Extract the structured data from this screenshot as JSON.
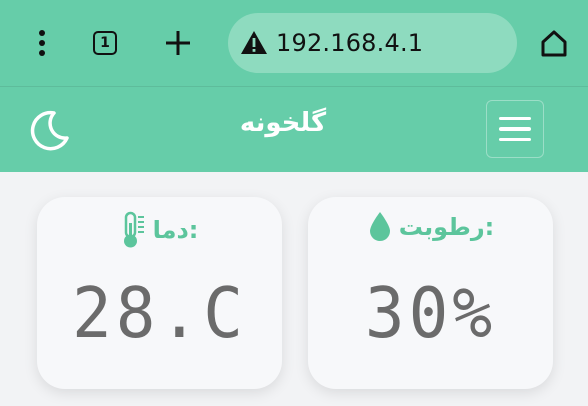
{
  "browser": {
    "tab_count": "1",
    "new_tab_label": "+",
    "url": "192.168.4.1"
  },
  "app": {
    "title": "گلخونه"
  },
  "cards": {
    "temperature": {
      "label": "دما:",
      "icon": "thermometer-icon",
      "value": "28.C"
    },
    "humidity": {
      "label": "رطوبت:",
      "icon": "water-drop-icon",
      "value": "30%"
    }
  },
  "colors": {
    "brand": "#66cda9",
    "url_bar": "#8edbbf",
    "accent_text": "#5cc59c",
    "value_text": "#6b6b6b",
    "background": "#f2f3f5"
  }
}
